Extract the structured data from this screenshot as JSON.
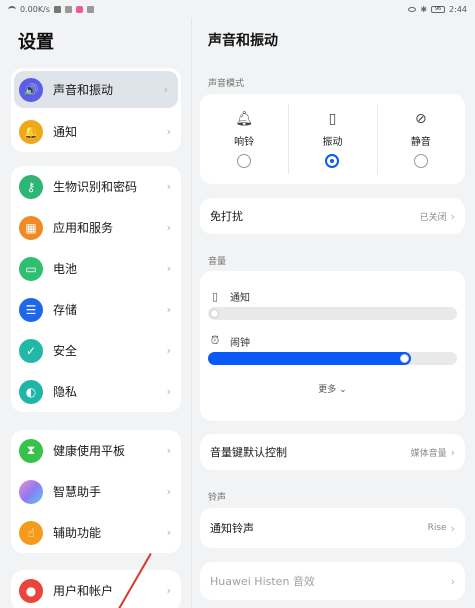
{
  "statusbar": {
    "speed": "0.00K/s",
    "battery": "96",
    "time": "2:44"
  },
  "left": {
    "title": "设置",
    "groups": [
      [
        {
          "label": "声音和振动",
          "icon": "speaker-icon",
          "color": "#5b5ce8",
          "active": true
        },
        {
          "label": "通知",
          "icon": "bell-icon",
          "color": "#f0a81b"
        }
      ],
      [
        {
          "label": "生物识别和密码",
          "icon": "key-icon",
          "color": "#2bb673"
        },
        {
          "label": "应用和服务",
          "icon": "apps-icon",
          "color": "#f08a24"
        },
        {
          "label": "电池",
          "icon": "battery-icon",
          "color": "#2fbf71"
        },
        {
          "label": "存储",
          "icon": "storage-icon",
          "color": "#1e67e8"
        },
        {
          "label": "安全",
          "icon": "shield-check-icon",
          "color": "#22b8a7"
        },
        {
          "label": "隐私",
          "icon": "privacy-icon",
          "color": "#1fb5a8"
        }
      ],
      [
        {
          "label": "健康使用平板",
          "icon": "hourglass-icon",
          "color": "#37c24b"
        },
        {
          "label": "智慧助手",
          "icon": "assistant-icon",
          "color": "#b66be8"
        },
        {
          "label": "辅助功能",
          "icon": "hand-icon",
          "color": "#f59a1c"
        }
      ],
      [
        {
          "label": "用户和帐户",
          "icon": "user-icon",
          "color": "#e8453c"
        }
      ]
    ]
  },
  "right": {
    "title": "声音和振动",
    "sound_mode": {
      "section": "声音模式",
      "options": [
        {
          "label": "响铃",
          "icon": "bell-icon",
          "selected": false
        },
        {
          "label": "振动",
          "icon": "vibrate-icon",
          "selected": true
        },
        {
          "label": "静音",
          "icon": "bell-off-icon",
          "selected": false
        }
      ]
    },
    "dnd": {
      "label": "免打扰",
      "value": "已关闭"
    },
    "volume": {
      "section": "音量",
      "notification": {
        "label": "通知",
        "level": 0.0
      },
      "alarm": {
        "label": "闹钟",
        "level": 0.79
      },
      "more": "更多"
    },
    "volume_key": {
      "label": "音量键默认控制",
      "value": "媒体音量"
    },
    "ringtone": {
      "section": "铃声",
      "notification_tone": {
        "label": "通知铃声",
        "value": "Rise"
      }
    },
    "histen": {
      "label": "Huawei Histen 音效"
    }
  }
}
